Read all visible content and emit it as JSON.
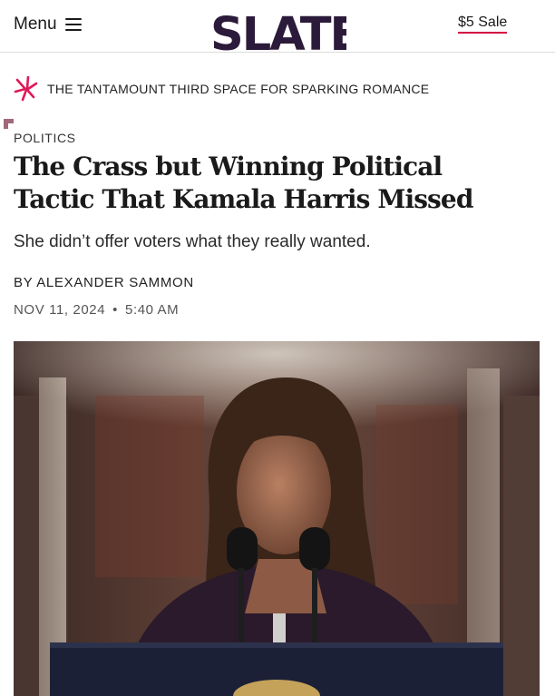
{
  "header": {
    "menu_label": "Menu",
    "logo_text": "SLATE",
    "sale_link": "$5 Sale"
  },
  "promo": {
    "text": "THE TANTAMOUNT THIRD SPACE FOR SPARKING ROMANCE"
  },
  "article": {
    "kicker": "POLITICS",
    "headline_line1": "The Crass but Winning Political",
    "headline_line2": "Tactic That Kamala Harris Missed",
    "dek": "She didn’t offer voters what they really wanted.",
    "byline_prefix": "BY",
    "author": "ALEXANDER SAMMON",
    "date": "NOV 11, 2024",
    "separator": "•",
    "time": "5:40 AM"
  },
  "colors": {
    "accent": "#d4003f",
    "logo": "#2b1a3a",
    "text": "#1a1a1a"
  }
}
